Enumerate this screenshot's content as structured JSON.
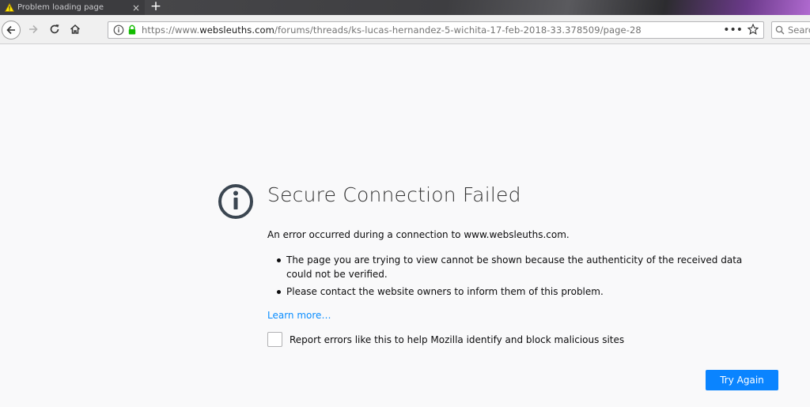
{
  "tab": {
    "title": "Problem loading page",
    "close_label": "×",
    "new_tab_label": "+"
  },
  "navbar": {
    "url_prefix": "https://www.",
    "url_domain": "websleuths.com",
    "url_path": "/forums/threads/ks-lucas-hernandez-5-wichita-17-feb-2018-33.378509/page-28",
    "page_actions_label": "•••",
    "search_placeholder": "Searc"
  },
  "error": {
    "title": "Secure Connection Failed",
    "description": "An error occurred during a connection to www.websleuths.com.",
    "bullets": [
      "The page you are trying to view cannot be shown because the authenticity of the received data could not be verified.",
      "Please contact the website owners to inform them of this problem."
    ],
    "learn_more": "Learn more…",
    "report_label": "Report errors like this to help Mozilla identify and block malicious sites",
    "try_again": "Try Again"
  },
  "colors": {
    "accent": "#0a84ff",
    "page_bg": "#f9f9fa",
    "icon": "#3b4651"
  },
  "icons": [
    "warning-icon",
    "back-arrow-icon",
    "forward-arrow-icon",
    "reload-icon",
    "home-icon",
    "info-icon",
    "lock-icon",
    "bookmark-star-icon",
    "search-icon",
    "error-info-icon"
  ]
}
